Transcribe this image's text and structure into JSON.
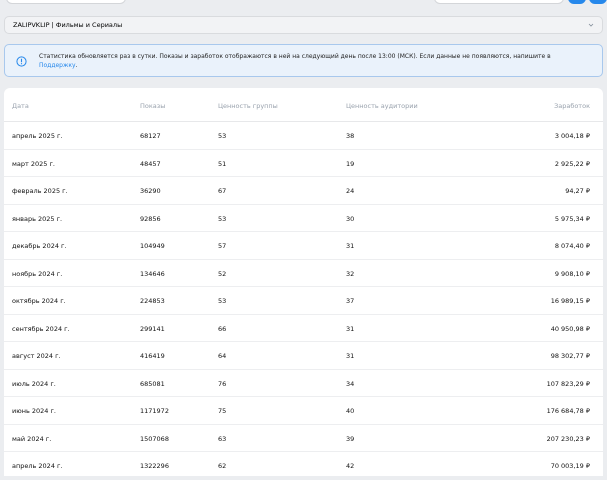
{
  "account_select": {
    "value": "ZALIPVKLIP | Фильмы и Сериалы"
  },
  "notice": {
    "text": "Статистика обновляется раз в сутки. Показы и заработок отображаются в ней на следующий день после 13:00 (МСК). Если данные не появляются, напишите в ",
    "link_label": "Поддержку",
    "suffix": "."
  },
  "table": {
    "headers": {
      "date": "Дата",
      "impressions": "Показы",
      "group_value": "Ценность группы",
      "audience_value": "Ценность аудитории",
      "earnings": "Заработок"
    },
    "rows": [
      {
        "date": "апрель 2025 г.",
        "impressions": "68127",
        "group_value": "53",
        "audience_value": "38",
        "earnings": "3 004,18 ₽"
      },
      {
        "date": "март 2025 г.",
        "impressions": "48457",
        "group_value": "51",
        "audience_value": "19",
        "earnings": "2 925,22 ₽"
      },
      {
        "date": "февраль 2025 г.",
        "impressions": "36290",
        "group_value": "67",
        "audience_value": "24",
        "earnings": "94,27 ₽"
      },
      {
        "date": "январь 2025 г.",
        "impressions": "92856",
        "group_value": "53",
        "audience_value": "30",
        "earnings": "5 975,34 ₽"
      },
      {
        "date": "декабрь 2024 г.",
        "impressions": "104949",
        "group_value": "57",
        "audience_value": "31",
        "earnings": "8 074,40 ₽"
      },
      {
        "date": "ноябрь 2024 г.",
        "impressions": "134646",
        "group_value": "52",
        "audience_value": "32",
        "earnings": "9 908,10 ₽"
      },
      {
        "date": "октябрь 2024 г.",
        "impressions": "224853",
        "group_value": "53",
        "audience_value": "37",
        "earnings": "16 989,15 ₽"
      },
      {
        "date": "сентябрь 2024 г.",
        "impressions": "299141",
        "group_value": "66",
        "audience_value": "31",
        "earnings": "40 950,98 ₽"
      },
      {
        "date": "август 2024 г.",
        "impressions": "416419",
        "group_value": "64",
        "audience_value": "31",
        "earnings": "98 302,77 ₽"
      },
      {
        "date": "июль 2024 г.",
        "impressions": "685081",
        "group_value": "76",
        "audience_value": "34",
        "earnings": "107 823,29 ₽"
      },
      {
        "date": "июнь 2024 г.",
        "impressions": "1171972",
        "group_value": "75",
        "audience_value": "40",
        "earnings": "176 684,78 ₽"
      },
      {
        "date": "май 2024 г.",
        "impressions": "1507068",
        "group_value": "63",
        "audience_value": "39",
        "earnings": "207 230,23 ₽"
      },
      {
        "date": "апрель 2024 г.",
        "impressions": "1322296",
        "group_value": "62",
        "audience_value": "42",
        "earnings": "70 003,19 ₽"
      }
    ]
  },
  "colors": {
    "accent": "#2688eb",
    "header_text": "#99a2ad",
    "notice_bg": "#eaf2fb",
    "notice_border": "#a8c8ed"
  },
  "icons": {
    "info": "info-circle-icon",
    "chevron": "chevron-down-icon"
  }
}
